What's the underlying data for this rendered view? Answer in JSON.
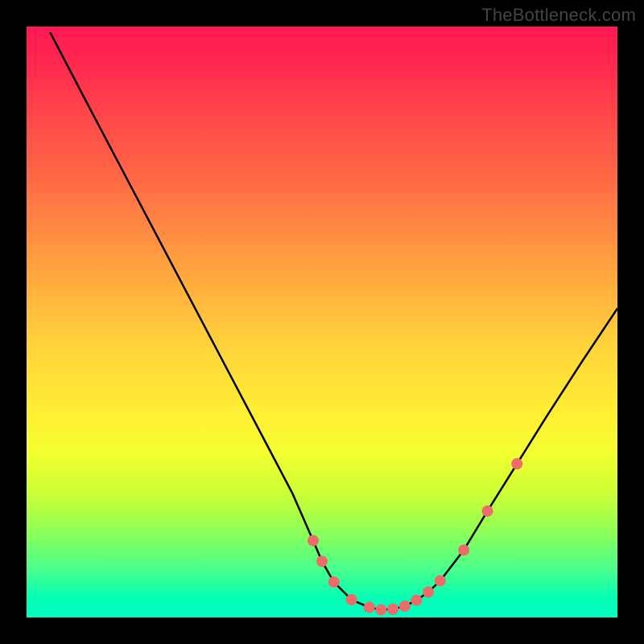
{
  "watermark": "TheBottleneck.com",
  "chart_data": {
    "type": "line",
    "title": "",
    "xlabel": "",
    "ylabel": "",
    "xlim": [
      0,
      100
    ],
    "ylim": [
      0,
      100
    ],
    "series": [
      {
        "name": "curve",
        "x": [
          4,
          10,
          20,
          30,
          40,
          45,
          48.5,
          50,
          52,
          55,
          58,
          60,
          62,
          64,
          66,
          68,
          70,
          74,
          78,
          83,
          88,
          94,
          100
        ],
        "y": [
          99,
          87.5,
          68.5,
          49.5,
          30.5,
          21,
          13,
          9.5,
          6,
          3,
          1.7,
          1.3,
          1.4,
          1.9,
          2.9,
          4.3,
          6.2,
          11.4,
          18,
          26,
          34,
          43.3,
          52.3
        ]
      }
    ],
    "dots": {
      "x": [
        48.5,
        50,
        52,
        55,
        58,
        60,
        62,
        64,
        66,
        68,
        70,
        74,
        78,
        83
      ],
      "y": [
        13,
        9.5,
        6,
        3,
        1.7,
        1.3,
        1.4,
        1.9,
        2.9,
        4.3,
        6.2,
        11.4,
        18,
        26
      ]
    },
    "gradient_colors": {
      "top": "#ff1852",
      "bottom": "#00ffc2"
    }
  }
}
